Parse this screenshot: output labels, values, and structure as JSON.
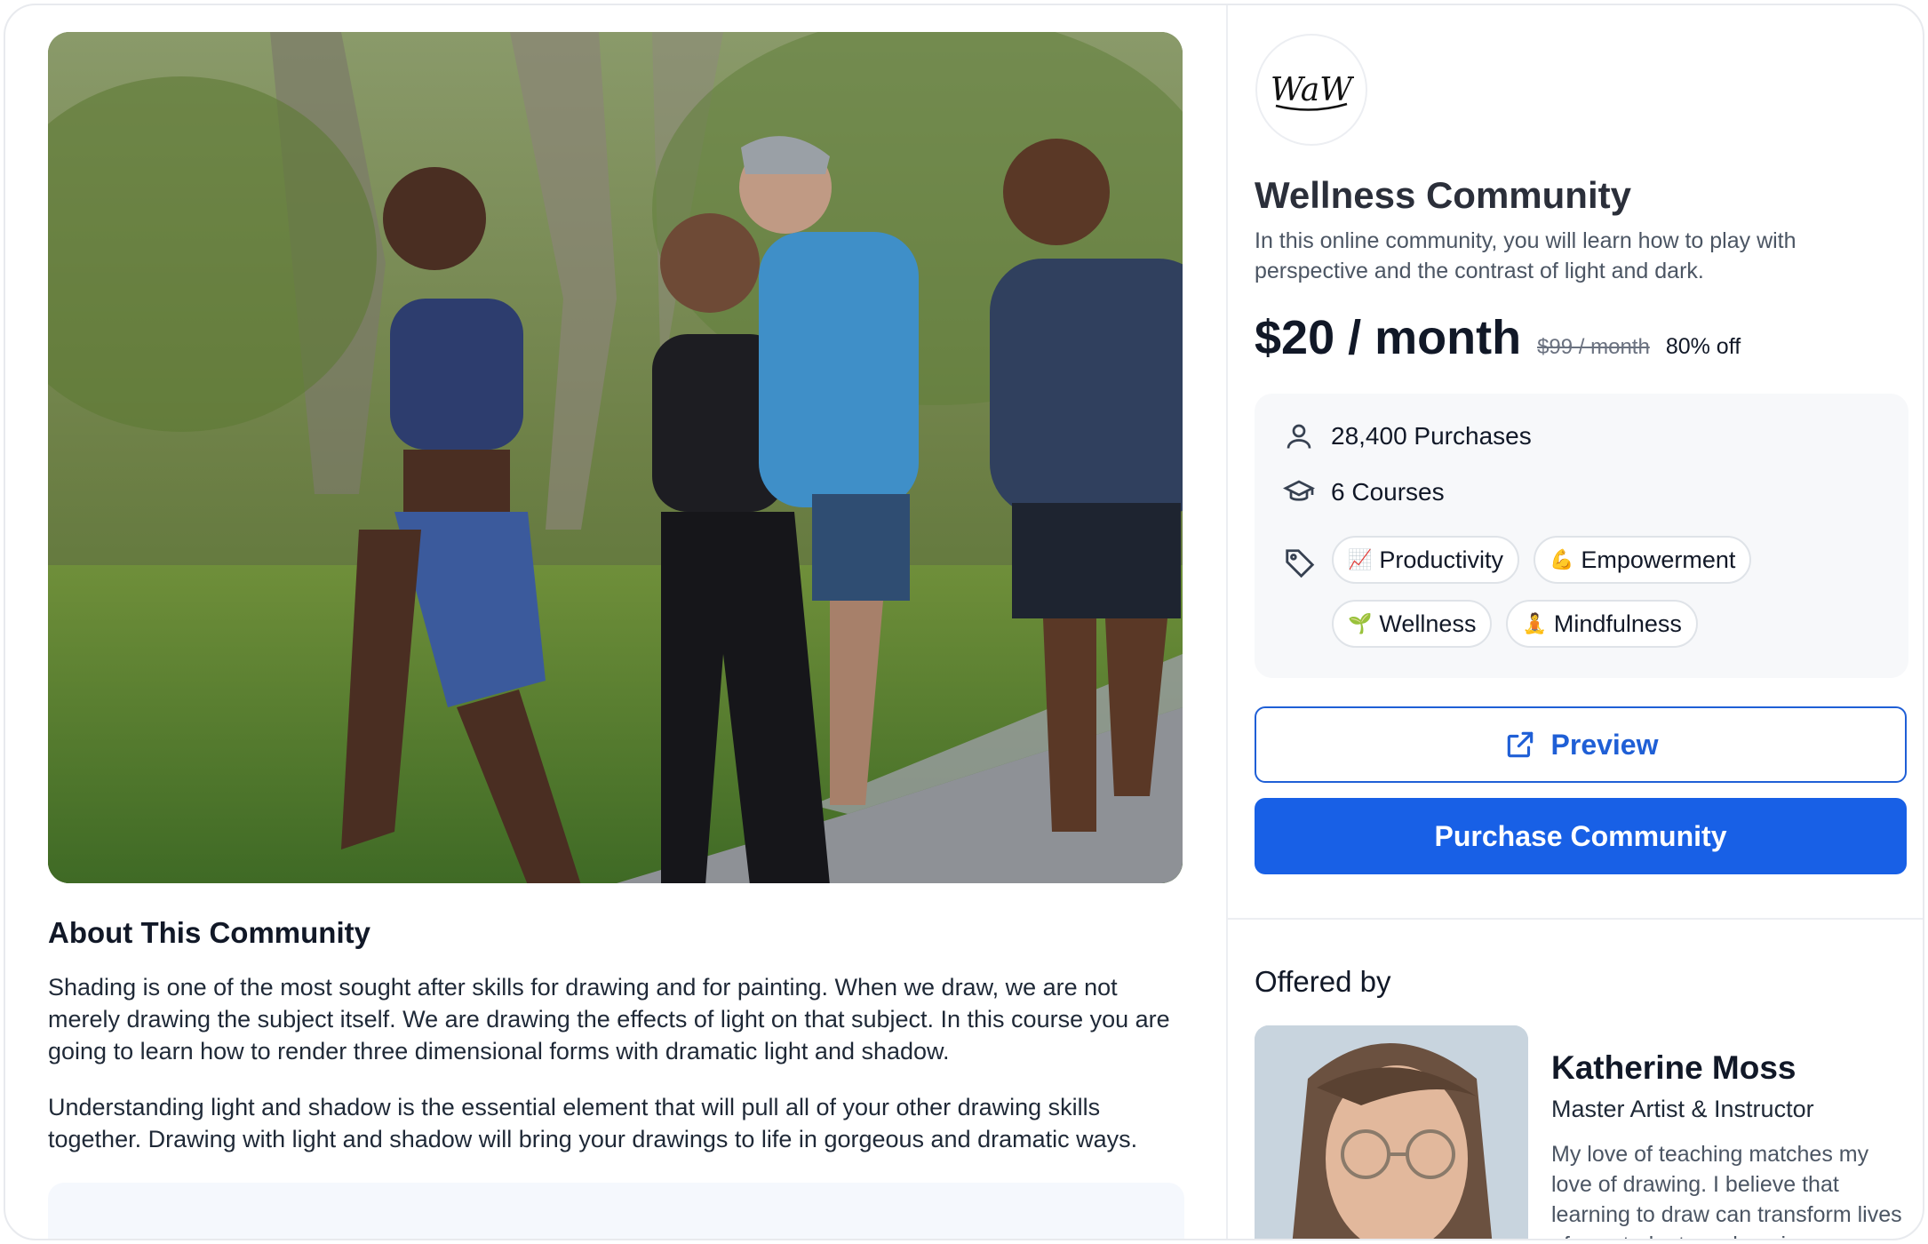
{
  "about": {
    "title": "About This Community",
    "paragraph1": "Shading is one of the most sought after skills for drawing and for painting. When we draw, we are not merely drawing the subject itself.  We are drawing the effects of light on that subject. In this course you are going to learn how to render three dimensional forms with dramatic light and shadow.",
    "paragraph2": "Understanding light and shadow is the essential element that will pull all of your other drawing skills together. Drawing with light and shadow will bring your drawings to life in gorgeous and dramatic ways."
  },
  "community": {
    "logo_text": "WaW",
    "title": "Wellness Community",
    "description": "In this online community, you will learn how to play with perspective and the contrast of light and dark.",
    "price": "$20 / month",
    "original_price": "$99 / month",
    "discount": "80% off"
  },
  "stats": {
    "purchases": "28,400 Purchases",
    "courses": "6 Courses",
    "tags": [
      {
        "emoji": "📈",
        "label": "Productivity"
      },
      {
        "emoji": "💪",
        "label": "Empowerment"
      },
      {
        "emoji": "🌱",
        "label": "Wellness"
      },
      {
        "emoji": "🧘",
        "label": "Mindfulness"
      }
    ]
  },
  "buttons": {
    "preview": "Preview",
    "purchase": "Purchase Community"
  },
  "instructor": {
    "section_label": "Offered by",
    "name": "Katherine Moss",
    "role": "Master Artist & Instructor",
    "bio": "My love of teaching matches my love of drawing. I believe that learning to draw can transform lives of my students, enhancing"
  },
  "colors": {
    "primary": "#1860e6",
    "primary_outline": "#1f5fd6",
    "stats_bg": "#f7f8fa"
  }
}
